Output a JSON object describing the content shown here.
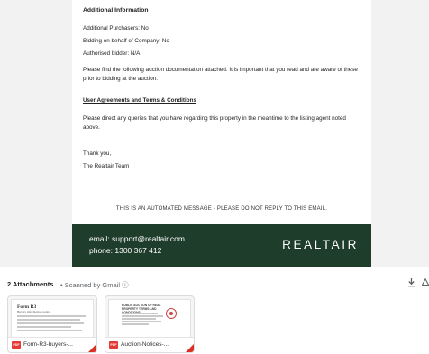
{
  "email": {
    "heading": "Additional Information",
    "lines": [
      "Additional Purchasers: No",
      "Bidding on behalf of Company: No",
      "Authorised bidder: N/A"
    ],
    "documentation_note": "Please find the following auction documentation attached. It is important that you read and are aware of these prior to bidding at the auction.",
    "link_label": "User Agreements and Terms & Conditions",
    "queries_note": "Please direct any queries that you have regarding this property in the meantime to the listing agent noted above.",
    "signoff": "Thank you,",
    "team": "The Realtair Team",
    "automated_notice": "THIS IS AN AUTOMATED MESSAGE - PLEASE DO NOT REPLY TO THIS EMAIL."
  },
  "footer": {
    "email": "email: support@realtair.com",
    "phone": "phone: 1300 367 412",
    "logo": "REALTAIR",
    "background_color": "#1f3d2b"
  },
  "attachments": {
    "count_label": "2 Attachments",
    "scan_label": "• Scanned by Gmail ⓘ",
    "download_icon": "download-icon",
    "add_to_drive_icon": "add-to-drive-icon",
    "files": [
      {
        "type_badge": "PDF",
        "name": "Form-R3-buyers-...",
        "preview_title": "Form R3",
        "preview_subtitle": "Buyers information notice"
      },
      {
        "type_badge": "PDF",
        "name": "Auction-Notices-...",
        "preview_title": "PUBLIC AUCTION OF REAL PROPERTY TERMS AND CONDITIONS"
      }
    ]
  }
}
